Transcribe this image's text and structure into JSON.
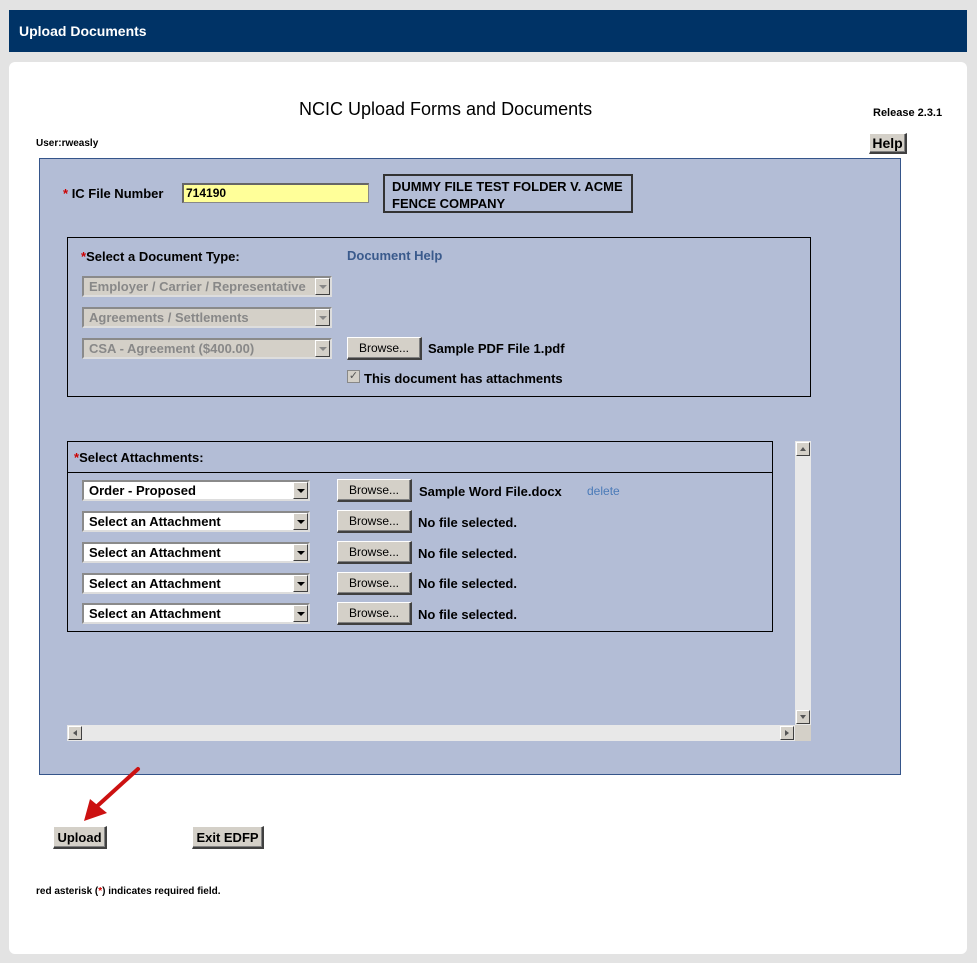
{
  "window": {
    "title": "Upload Documents"
  },
  "page": {
    "title": "NCIC Upload Forms and Documents",
    "release": "Release 2.3.1",
    "user": "User:rweasly",
    "help_label": "Help"
  },
  "ic_file": {
    "asterisk": "*",
    "label": "IC File Number",
    "value": "714190",
    "case_title": "DUMMY FILE TEST FOLDER V. ACME FENCE COMPANY"
  },
  "document_type": {
    "asterisk": "*",
    "label": "Select a Document Type:",
    "help_link": "Document Help",
    "select1": "Employer / Carrier / Representative",
    "select2": "Agreements / Settlements",
    "select3": "CSA - Agreement ($400.00)",
    "browse_label": "Browse...",
    "file_name": "Sample PDF File 1.pdf",
    "attachments_checkbox_label": "This document has attachments",
    "attachments_checked": true
  },
  "attachments": {
    "asterisk": "*",
    "label": "Select Attachments:",
    "delete_label": "delete",
    "rows": [
      {
        "type": "Order - Proposed",
        "browse": "Browse...",
        "file": "Sample Word File.docx"
      },
      {
        "type": "Select an Attachment",
        "browse": "Browse...",
        "file": "No file selected."
      },
      {
        "type": "Select an Attachment",
        "browse": "Browse...",
        "file": "No file selected."
      },
      {
        "type": "Select an Attachment",
        "browse": "Browse...",
        "file": "No file selected."
      },
      {
        "type": "Select an Attachment",
        "browse": "Browse...",
        "file": "No file selected."
      }
    ]
  },
  "actions": {
    "upload": "Upload",
    "exit": "Exit EDFP"
  },
  "footnote": {
    "before": "red asterisk (",
    "asterisk": "*",
    "after": ") indicates required field."
  },
  "colors": {
    "title_bar": "#003366",
    "form_bg": "#b3bdd6",
    "ic_input_bg": "#ffff99",
    "required": "#cc0000",
    "link": "#3a5a8c"
  }
}
